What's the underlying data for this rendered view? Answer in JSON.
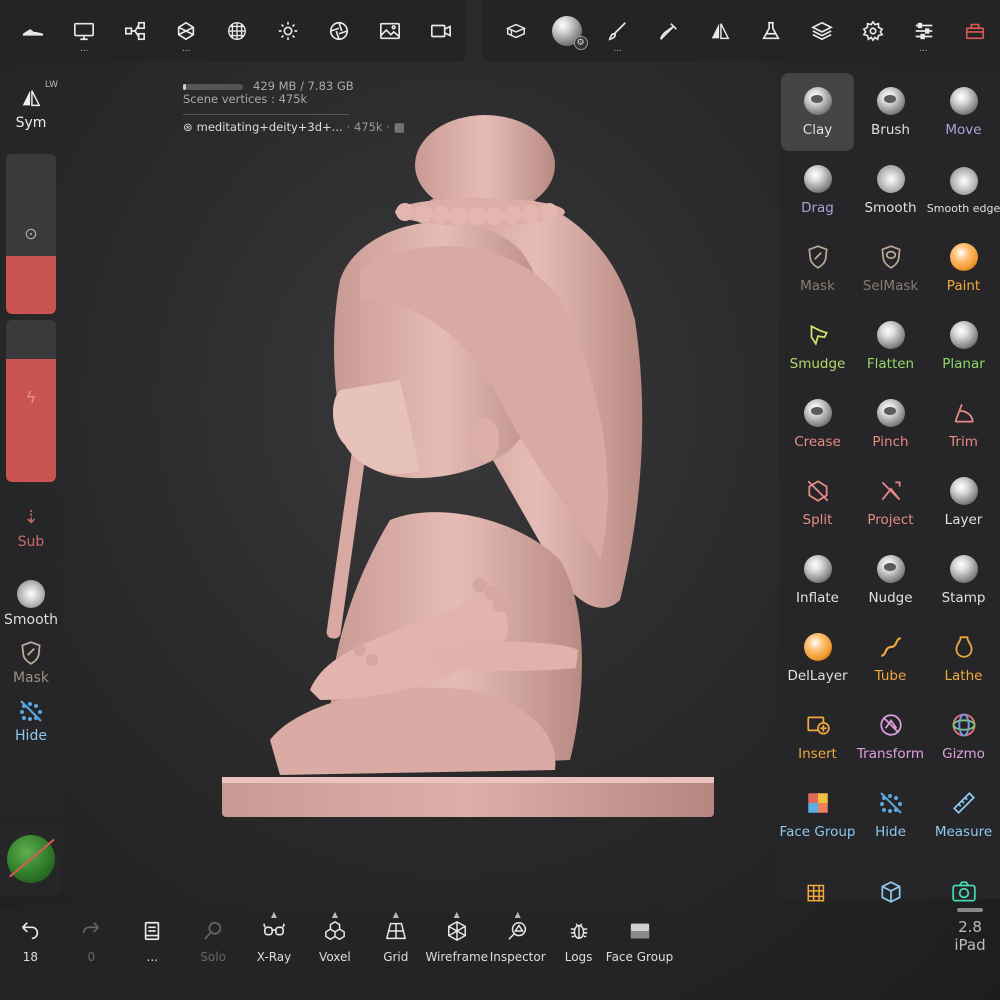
{
  "top_left_tools": [
    {
      "icon": "shoe-icon",
      "dots": ""
    },
    {
      "icon": "monitor-icon",
      "dots": "..."
    },
    {
      "icon": "node-graph-icon",
      "dots": ""
    },
    {
      "icon": "mesh-cube-icon",
      "dots": "..."
    },
    {
      "icon": "sphere-grid-icon",
      "dots": ""
    },
    {
      "icon": "sun-icon",
      "dots": ""
    },
    {
      "icon": "aperture-icon",
      "dots": ""
    },
    {
      "icon": "image-icon",
      "dots": ""
    },
    {
      "icon": "video-icon",
      "dots": ""
    }
  ],
  "top_right_tools": [
    {
      "icon": "box-stack-icon",
      "dots": ""
    },
    {
      "icon": "material-orb-icon",
      "dots": ""
    },
    {
      "icon": "brush-pen-icon",
      "dots": "..."
    },
    {
      "icon": "picker-icon",
      "dots": ""
    },
    {
      "icon": "symmetry-icon",
      "dots": ""
    },
    {
      "icon": "flask-icon",
      "dots": ""
    },
    {
      "icon": "layers-icon",
      "dots": ""
    },
    {
      "icon": "gear-icon",
      "dots": ""
    },
    {
      "icon": "sliders-icon",
      "dots": "..."
    },
    {
      "icon": "toolbox-icon",
      "dots": ""
    }
  ],
  "stats": {
    "memory": "429 MB / 7.83 GB",
    "memory_fraction": 0.05,
    "vertices": "Scene vertices : 475k",
    "mesh_name": "meditating+deity+3d+...",
    "mesh_count": "· 475k ·"
  },
  "left": {
    "sym_label": "Sym",
    "sym_badge": "LW",
    "radius_fraction": 0.36,
    "intensity_fraction": 0.76,
    "sub_label": "Sub",
    "tools": [
      {
        "label": "Smooth",
        "icon": "smooth-icon"
      },
      {
        "label": "Mask",
        "icon": "mask-icon"
      },
      {
        "label": "Hide",
        "icon": "hide-icon"
      }
    ]
  },
  "tools": [
    {
      "label": "Clay",
      "color": "#e0e0e0",
      "kind": "ball-dent",
      "selected": true
    },
    {
      "label": "Brush",
      "color": "#e0e0e0",
      "kind": "ball-dent"
    },
    {
      "label": "Move",
      "color": "#a9a4d8",
      "kind": "ball"
    },
    {
      "label": "Drag",
      "color": "#a9a4d8",
      "kind": "ball"
    },
    {
      "label": "Smooth",
      "color": "#e0e0e0",
      "kind": "spiky"
    },
    {
      "label": "Smooth edge",
      "color": "#e0e0e0",
      "kind": "spiky",
      "small": true
    },
    {
      "label": "Mask",
      "color": "#8a7d72",
      "kind": "shield"
    },
    {
      "label": "SelMask",
      "color": "#8a7d72",
      "kind": "lasso"
    },
    {
      "label": "Paint",
      "color": "#f0a840",
      "kind": "orange"
    },
    {
      "label": "Smudge",
      "color": "#b4d86a",
      "kind": "finger"
    },
    {
      "label": "Flatten",
      "color": "#8fd86a",
      "kind": "ball"
    },
    {
      "label": "Planar",
      "color": "#8fd86a",
      "kind": "ball"
    },
    {
      "label": "Crease",
      "color": "#e88a86",
      "kind": "ball-dent"
    },
    {
      "label": "Pinch",
      "color": "#e88a86",
      "kind": "ball-dent"
    },
    {
      "label": "Trim",
      "color": "#e88a86",
      "kind": "trim"
    },
    {
      "label": "Split",
      "color": "#e88a86",
      "kind": "split"
    },
    {
      "label": "Project",
      "color": "#e88a86",
      "kind": "project"
    },
    {
      "label": "Layer",
      "color": "#e0e0e0",
      "kind": "ball"
    },
    {
      "label": "Inflate",
      "color": "#e0e0e0",
      "kind": "ball"
    },
    {
      "label": "Nudge",
      "color": "#e0e0e0",
      "kind": "ball-dent"
    },
    {
      "label": "Stamp",
      "color": "#e0e0e0",
      "kind": "ball"
    },
    {
      "label": "DelLayer",
      "color": "#e0e0e0",
      "kind": "orange"
    },
    {
      "label": "Tube",
      "color": "#f0a840",
      "kind": "tube"
    },
    {
      "label": "Lathe",
      "color": "#f0a840",
      "kind": "vase"
    },
    {
      "label": "Insert",
      "color": "#f0a840",
      "kind": "insert"
    },
    {
      "label": "Transform",
      "color": "#e0a0e0",
      "kind": "transform"
    },
    {
      "label": "Gizmo",
      "color": "#e0a0e0",
      "kind": "gizmo"
    },
    {
      "label": "Face Group",
      "color": "#8ec8f0",
      "kind": "facegroup"
    },
    {
      "label": "Hide",
      "color": "#8ec8f0",
      "kind": "hide"
    },
    {
      "label": "Measure",
      "color": "#8ec8f0",
      "kind": "ruler"
    },
    {
      "label": "",
      "color": "#e0e0e0",
      "kind": "shop"
    },
    {
      "label": "",
      "color": "#8ec8f0",
      "kind": "box"
    },
    {
      "label": "",
      "color": "#4ad8b0",
      "kind": "camera"
    }
  ],
  "bottom": [
    {
      "label": "18",
      "icon": "undo-icon"
    },
    {
      "label": "0",
      "icon": "redo-icon",
      "dim": true
    },
    {
      "label": "...",
      "icon": "book-icon"
    },
    {
      "label": "Solo",
      "icon": "search-icon",
      "dim": true
    },
    {
      "label": "X-Ray",
      "icon": "glasses-icon",
      "caret": true
    },
    {
      "label": "Voxel",
      "icon": "voxel-icon",
      "caret": true
    },
    {
      "label": "Grid",
      "icon": "grid-plane-icon",
      "caret": true
    },
    {
      "label": "Wireframe",
      "icon": "wireframe-icon",
      "caret": true
    },
    {
      "label": "Inspector",
      "icon": "inspector-icon",
      "caret": true
    },
    {
      "label": "Logs",
      "icon": "bug-icon"
    },
    {
      "label": "Face Group",
      "icon": "face-group-icon"
    }
  ],
  "version": {
    "number": "2.8",
    "device": "iPad"
  }
}
